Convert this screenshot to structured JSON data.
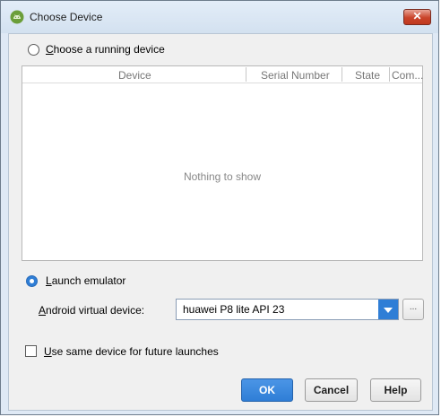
{
  "window": {
    "title": "Choose Device",
    "close_glyph": "✕",
    "title_icon": "android-icon"
  },
  "running_device": {
    "label_prefix": "",
    "label_mnemonic": "C",
    "label_rest": "hoose a running device",
    "selected": false
  },
  "device_table": {
    "columns": [
      "Device",
      "Serial Number",
      "State",
      "Com..."
    ],
    "empty_text": "Nothing to show"
  },
  "launch_emulator": {
    "label_mnemonic": "L",
    "label_rest": "aunch emulator",
    "selected": true
  },
  "avd": {
    "label_mnemonic": "A",
    "label_rest": "ndroid virtual device:",
    "selected_value": "huawei P8 lite API 23",
    "more_glyph": "..."
  },
  "same_device": {
    "label_mnemonic": "U",
    "label_rest": "se same device for future launches",
    "checked": false
  },
  "buttons": {
    "ok": "OK",
    "cancel": "Cancel",
    "help": "Help"
  },
  "colors": {
    "accent": "#2f7ed6",
    "close": "#c9442a",
    "frame": "#dfe9f5"
  }
}
